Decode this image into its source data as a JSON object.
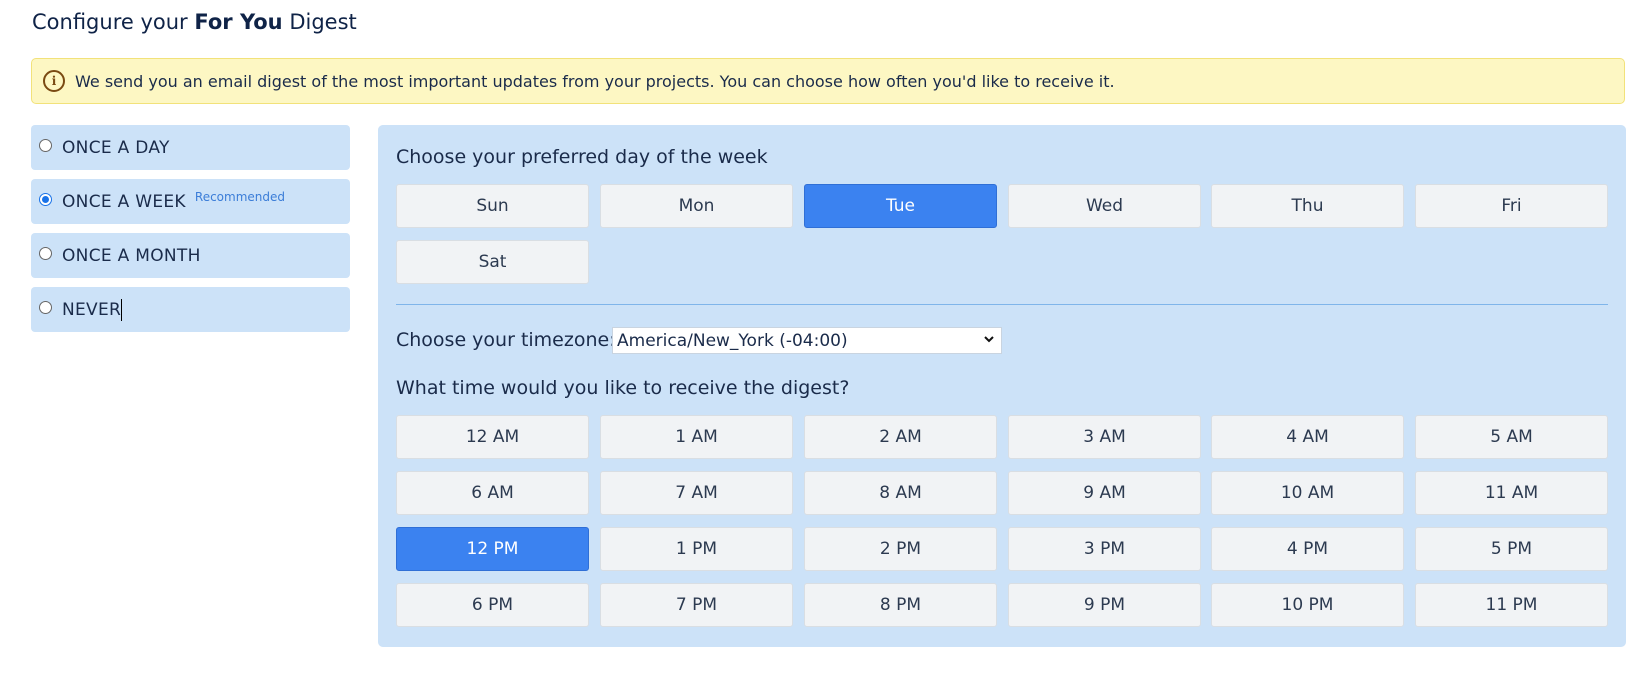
{
  "title": {
    "prefix": "Configure your",
    "bold": "For You",
    "suffix": "Digest"
  },
  "notice": {
    "icon": "info-icon",
    "text": "We send you an email digest of the most important updates from your projects. You can choose how often you'd like to receive it."
  },
  "frequency": {
    "options": [
      {
        "label": "ONCE A DAY",
        "checked": false
      },
      {
        "label": "ONCE A WEEK",
        "checked": true,
        "badge": "Recommended"
      },
      {
        "label": "ONCE A MONTH",
        "checked": false
      },
      {
        "label": "NEVER",
        "checked": false
      }
    ]
  },
  "day_section": {
    "label": "Choose your preferred day of the week",
    "days": [
      "Sun",
      "Mon",
      "Tue",
      "Wed",
      "Thu",
      "Fri",
      "Sat"
    ],
    "selected": "Tue"
  },
  "timezone": {
    "label": "Choose your timezone:",
    "value": "America/New_York (-04:00)"
  },
  "time_section": {
    "label": "What time would you like to receive the digest?",
    "times": [
      "12 AM",
      "1 AM",
      "2 AM",
      "3 AM",
      "4 AM",
      "5 AM",
      "6 AM",
      "7 AM",
      "8 AM",
      "9 AM",
      "10 AM",
      "11 AM",
      "12 PM",
      "1 PM",
      "2 PM",
      "3 PM",
      "4 PM",
      "5 PM",
      "6 PM",
      "7 PM",
      "8 PM",
      "9 PM",
      "10 PM",
      "11 PM"
    ],
    "selected": "12 PM"
  },
  "colors": {
    "accent": "#3b82f0",
    "panel": "#cce2f8",
    "notice_bg": "#fdf7c3"
  }
}
